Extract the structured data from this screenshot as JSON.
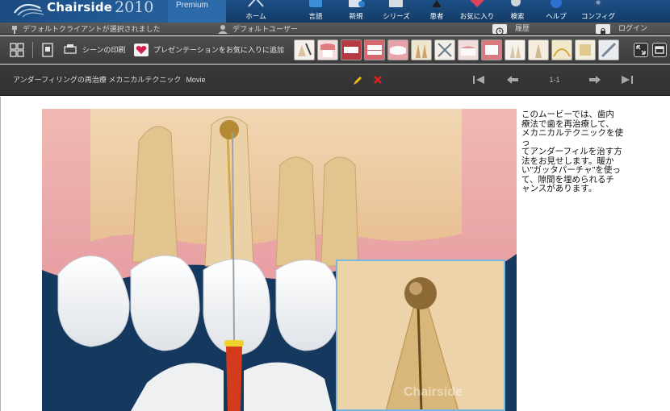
{
  "app": {
    "name": "Chairside",
    "year": "2010",
    "edition": "Premium"
  },
  "nav": [
    {
      "label": "ホーム",
      "icon": "home-icon"
    },
    {
      "label": "言語",
      "icon": "language-icon"
    },
    {
      "label": "新規",
      "icon": "new-icon"
    },
    {
      "label": "シリーズ",
      "icon": "series-icon"
    },
    {
      "label": "患者",
      "icon": "patient-icon"
    },
    {
      "label": "お気に入り",
      "icon": "favorites-icon"
    },
    {
      "label": "検索",
      "icon": "search-icon"
    },
    {
      "label": "ヘルプ",
      "icon": "help-icon"
    },
    {
      "label": "コンフィグ",
      "icon": "config-icon"
    }
  ],
  "status": {
    "client": "デフォルトクライアントが選択されました",
    "user": "デフォルトユーザー",
    "history": "履歴",
    "login": "ログイン"
  },
  "toolbar": {
    "print_scene": "シーンの印刷",
    "add_presentation": "プレゼンテーションをお気に入りに追加"
  },
  "movie": {
    "title": "アンダーフィリングの再治療 メカニカルテクニック",
    "type": "Movie",
    "page": "1-1",
    "watermark": "Chairside",
    "description": "このムービーでは、歯内\n療法で歯を再治療して、\nメカニカルテクニックを使っ\nてアンダーフィルを治す方\n法をお見せします。暖か\nい\"ガッタパーチャ\"を使っ\nて、隙間を埋められるチ\nャンスがあります。"
  },
  "colors": {
    "nav_bg": "#174474",
    "brand_accent": "#2d6aaa",
    "gum": "#e79ea2",
    "tooth": "#f4efe9",
    "inset_border": "#79b6e0",
    "edit": "#f2c200",
    "delete": "#e02020"
  }
}
